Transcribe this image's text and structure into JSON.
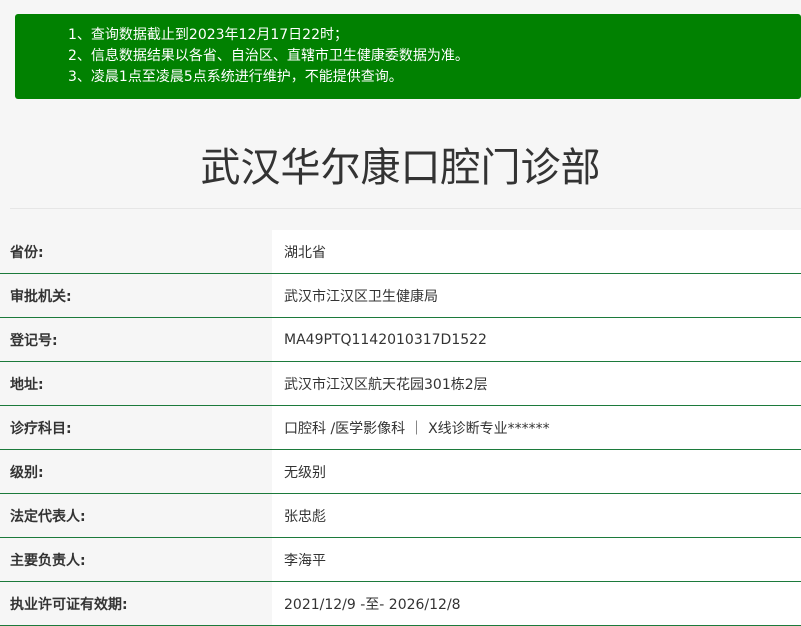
{
  "notice": {
    "lines": [
      "1、查询数据截止到2023年12月17日22时；",
      "2、信息数据结果以各省、自治区、直辖市卫生健康委数据为准。",
      "3、凌晨1点至凌晨5点系统进行维护，不能提供查询。"
    ]
  },
  "clinic": {
    "name": "武汉华尔康口腔门诊部"
  },
  "details": [
    {
      "label": "省份:",
      "value": "湖北省"
    },
    {
      "label": "审批机关:",
      "value": "武汉市江汉区卫生健康局"
    },
    {
      "label": "登记号:",
      "value": "MA49PTQ1142010317D1522"
    },
    {
      "label": "地址:",
      "value": "武汉市江汉区航天花园301栋2层"
    },
    {
      "label": "诊疗科目:",
      "value": "口腔科 /医学影像科 ｜ X线诊断专业******"
    },
    {
      "label": "级别:",
      "value": "无级别"
    },
    {
      "label": "法定代表人:",
      "value": "张忠彪"
    },
    {
      "label": "主要负责人:",
      "value": "李海平"
    },
    {
      "label": "执业许可证有效期:",
      "value": "2021/12/9 -至- 2026/12/8"
    }
  ]
}
